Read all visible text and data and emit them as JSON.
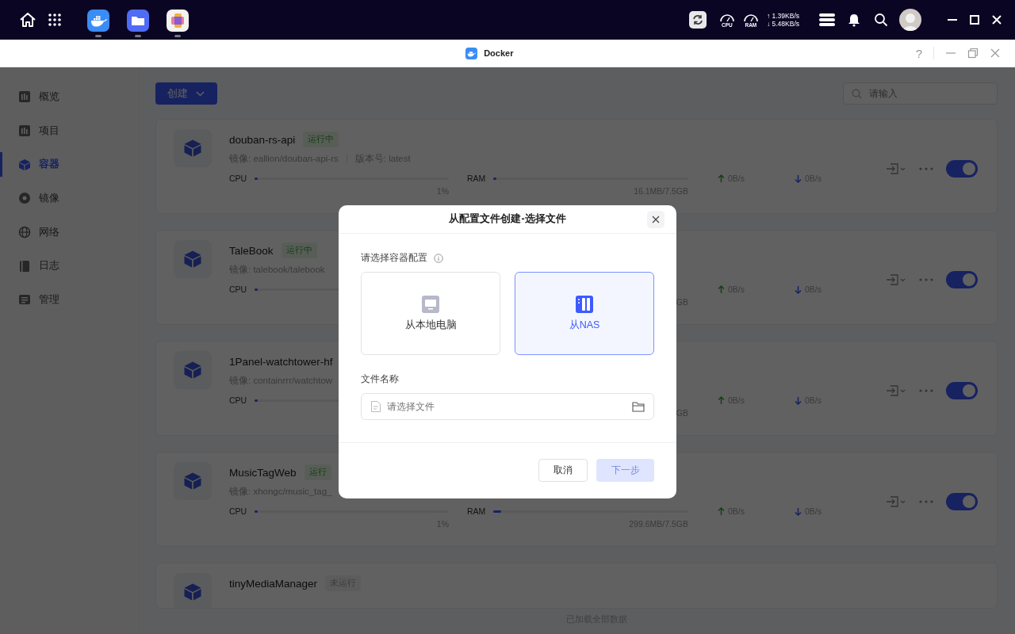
{
  "taskbar": {
    "apps": [
      {
        "kind": "docker"
      },
      {
        "kind": "files"
      },
      {
        "kind": "photos"
      }
    ],
    "gauges": [
      {
        "label": "CPU"
      },
      {
        "label": "RAM"
      }
    ],
    "net_speed": {
      "up": "↑ 1.39KB/s",
      "down": "↓ 5.48KB/s"
    }
  },
  "window": {
    "title": "Docker",
    "help": "?"
  },
  "sidebar": {
    "items": [
      {
        "label": "概览",
        "kind": "overview",
        "selected": false
      },
      {
        "label": "项目",
        "kind": "project",
        "selected": false
      },
      {
        "label": "容器",
        "kind": "container",
        "selected": true
      },
      {
        "label": "镜像",
        "kind": "image",
        "selected": false
      },
      {
        "label": "网络",
        "kind": "network",
        "selected": false
      },
      {
        "label": "日志",
        "kind": "log",
        "selected": false
      },
      {
        "label": "管理",
        "kind": "manage",
        "selected": false
      }
    ]
  },
  "toolbar": {
    "create_button": "创建",
    "search": {
      "placeholder": "请输入"
    }
  },
  "containers": [
    {
      "name": "douban-rs-api",
      "status": "运行中",
      "kind": "running",
      "image": "镜像: eallion/douban-api-rs",
      "version": "版本号: latest",
      "cpu": {
        "label": "CPU",
        "level": 0.01,
        "reading": "1%"
      },
      "ram": {
        "label": "RAM",
        "level": 0.01,
        "reading": "16.1MB/7.5GB"
      },
      "upload": "0B/s",
      "download": "0B/s",
      "enabled": true
    },
    {
      "name": "TaleBook",
      "status": "运行中",
      "kind": "running",
      "image": "镜像: talebook/talebook",
      "cpu": {
        "label": "CPU",
        "level": 0.01
      },
      "ram": {
        "reading": "GB"
      },
      "upload": "0B/s",
      "download": "0B/s",
      "enabled": true
    },
    {
      "name": "1Panel-watchtower-hf",
      "image": "镜像: containrrr/watchtow",
      "cpu": {
        "label": "CPU",
        "level": 0.01
      },
      "ram": {
        "reading": "GB"
      },
      "upload": "0B/s",
      "download": "0B/s",
      "enabled": true
    },
    {
      "name": "MusicTagWeb",
      "status": "运行",
      "kind": "running",
      "image": "镜像: xhongc/music_tag_",
      "cpu": {
        "label": "CPU",
        "level": 0.01,
        "reading": "1%"
      },
      "ram": {
        "label": "RAM",
        "level": 0.04,
        "reading": "299.6MB/7.5GB"
      },
      "upload": "0B/s",
      "download": "0B/s",
      "enabled": true
    },
    {
      "name": "tinyMediaManager",
      "status": "未运行",
      "kind": "stopped"
    }
  ],
  "footer_note": "已加载全部数据",
  "dialog": {
    "title": "从配置文件创建-选择文件",
    "source_label": "请选择容器配置",
    "sources": [
      {
        "label": "从本地电脑",
        "kind": "computer",
        "selected": false
      },
      {
        "label": "从NAS",
        "kind": "nas",
        "selected": true
      }
    ],
    "file_label": "文件名称",
    "file_field": {
      "placeholder": "请选择文件"
    },
    "buttons": [
      {
        "label": "取消",
        "kind": "secondary",
        "disabled": false
      },
      {
        "label": "下一步",
        "kind": "primary",
        "disabled": true
      }
    ]
  }
}
